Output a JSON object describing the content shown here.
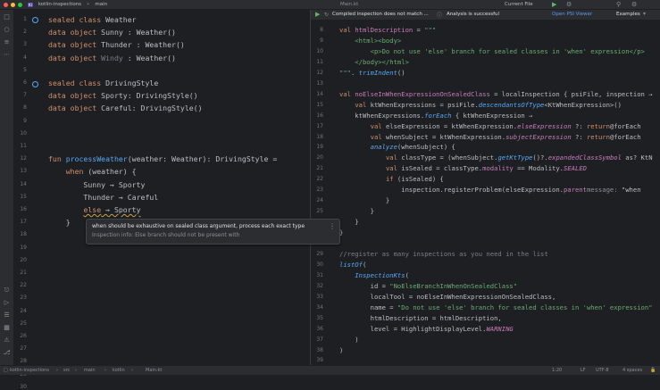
{
  "titlebar": {
    "project_badge": "KI",
    "project": "kotlin-inspections",
    "branch": "main",
    "file_center": "Main.kt",
    "run_config": "Current File"
  },
  "right_header": {
    "notification_1": "Compiled inspection does not match ...",
    "notification_2": "Analysis is successful",
    "psi_viewer": "Open PSI Viewer",
    "examples": "Examples"
  },
  "left_editor": {
    "line_numbers": [
      "1",
      "2",
      "3",
      "4",
      "5",
      "6",
      "7",
      "8",
      "9",
      "10",
      "11",
      "12",
      "13",
      "14",
      "15",
      "16",
      "17",
      "18",
      "19",
      "20",
      "21",
      "22",
      "23",
      "24",
      "25",
      "26",
      "27",
      "28",
      "29",
      "30"
    ],
    "lines": [
      [
        [
          "kw",
          "sealed class "
        ],
        [
          "",
          "Weather"
        ]
      ],
      [
        [
          "kw",
          "data object "
        ],
        [
          "",
          "Sunny : Weather()"
        ]
      ],
      [
        [
          "kw",
          "data object "
        ],
        [
          "",
          "Thunder : Weather()"
        ]
      ],
      [
        [
          "kw",
          "data object "
        ],
        [
          "muted",
          "Windy"
        ],
        [
          "",
          " : Weather()"
        ]
      ],
      [],
      [
        [
          "kw",
          "sealed class "
        ],
        [
          "",
          "DrivingStyle"
        ]
      ],
      [
        [
          "kw",
          "data object "
        ],
        [
          "",
          "Sporty: DrivingStyle()"
        ]
      ],
      [
        [
          "kw",
          "data object "
        ],
        [
          "",
          "Careful: DrivingStyle()"
        ]
      ],
      [],
      [],
      [],
      [
        [
          "kw",
          "fun "
        ],
        [
          "fn",
          "processWeather"
        ],
        [
          "",
          "(weather: Weather): DrivingStyle ="
        ]
      ],
      [
        [
          "",
          "    "
        ],
        [
          "kw",
          "when"
        ],
        [
          "",
          " (weather) {"
        ]
      ],
      [
        [
          "",
          "        Sunny → Sporty"
        ]
      ],
      [
        [
          "",
          "        Thunder → Careful"
        ]
      ],
      [
        [
          "",
          "        "
        ],
        [
          "kw warn-u",
          "else"
        ],
        [
          "warn-u",
          " → Sporty"
        ]
      ],
      [
        [
          "",
          "    }"
        ]
      ]
    ]
  },
  "popup": {
    "message": "when should be exhaustive on sealed class argument, process each exact type",
    "info": "Inspection info: Else branch should not be present with"
  },
  "right_editor": {
    "line_numbers": [
      "8",
      "9",
      "10",
      "11",
      "12",
      "13",
      "14",
      "15",
      "16",
      "17",
      "18",
      "19",
      "20",
      "21",
      "22",
      "23",
      "24",
      "25",
      "26",
      "27",
      "28",
      "29",
      "30",
      "31",
      "32",
      "33",
      "34",
      "35",
      "36",
      "37",
      "38",
      "39"
    ],
    "lines": [
      [
        [
          "kw",
          "val "
        ],
        [
          "prop",
          "htmlDescription"
        ],
        [
          "",
          " = "
        ],
        [
          "str",
          "\"\"\""
        ]
      ],
      [
        [
          "str",
          "    <html><body>"
        ]
      ],
      [
        [
          "str",
          "        <p>Do not use 'else' branch for sealed classes in 'when' expression</p>"
        ]
      ],
      [
        [
          "str",
          "    </body></html>"
        ]
      ],
      [
        [
          "str",
          "\"\"\""
        ],
        [
          "",
          ". "
        ],
        [
          "fn it",
          "trimIndent"
        ],
        [
          "",
          "()"
        ]
      ],
      [],
      [
        [
          "kw",
          "val "
        ],
        [
          "prop",
          "noElseInWhenExpressionOnSealedClass"
        ],
        [
          "",
          " = localInspection { psiFile, inspection →"
        ]
      ],
      [
        [
          "",
          "    "
        ],
        [
          "kw",
          "val "
        ],
        [
          "",
          "ktWhenExpressions = psiFile."
        ],
        [
          "fn it",
          "descendantsOfType"
        ],
        [
          "",
          "<KtWhenExpression>()"
        ]
      ],
      [
        [
          "",
          "    ktWhenExpressions."
        ],
        [
          "fn it",
          "forEach"
        ],
        [
          "",
          " { ktWhenExpression →"
        ]
      ],
      [
        [
          "",
          "        "
        ],
        [
          "kw",
          "val "
        ],
        [
          "",
          "elseExpression = ktWhenExpression."
        ],
        [
          "prop it",
          "elseExpression"
        ],
        [
          "",
          " ?: "
        ],
        [
          "kw",
          "return"
        ],
        [
          "",
          "@forEach"
        ]
      ],
      [
        [
          "",
          "        "
        ],
        [
          "kw",
          "val "
        ],
        [
          "",
          "whenSubject = ktWhenExpression."
        ],
        [
          "prop it",
          "subjectExpression"
        ],
        [
          "",
          " ?: "
        ],
        [
          "kw",
          "return"
        ],
        [
          "",
          "@forEach"
        ]
      ],
      [
        [
          "",
          "        "
        ],
        [
          "fn it",
          "analyze"
        ],
        [
          "",
          "(whenSubject) {"
        ]
      ],
      [
        [
          "",
          "            "
        ],
        [
          "kw",
          "val "
        ],
        [
          "",
          "classType = (whenSubject."
        ],
        [
          "fn it",
          "getKtType"
        ],
        [
          "",
          "()?."
        ],
        [
          "prop it",
          "expandedClassSymbol"
        ],
        [
          "",
          " as? KtN"
        ]
      ],
      [
        [
          "",
          "            "
        ],
        [
          "kw",
          "val "
        ],
        [
          "",
          "isSealed = classType."
        ],
        [
          "prop",
          "modality"
        ],
        [
          "",
          " == Modality."
        ],
        [
          "enumc",
          "SEALED"
        ]
      ],
      [
        [
          "",
          "            "
        ],
        [
          "kw",
          "if "
        ],
        [
          "",
          "(isSealed) {"
        ]
      ],
      [
        [
          "",
          "                inspection.registerProblem(elseExpression."
        ],
        [
          "prop",
          "parent"
        ],
        [
          ",  "
        ],
        [
          "hl",
          "message:"
        ],
        [
          "",
          " \"when"
        ]
      ],
      [
        [
          "",
          "            }"
        ]
      ],
      [
        [
          "",
          "        }"
        ]
      ],
      [
        [
          "",
          "    }"
        ]
      ],
      [
        [
          "",
          "}"
        ]
      ],
      [],
      [
        [
          "cm",
          "//register as many inspections as you need in the list"
        ]
      ],
      [
        [
          "fn it",
          "listOf"
        ],
        [
          "",
          "("
        ]
      ],
      [
        [
          "",
          "    "
        ],
        [
          "fn it",
          "InspectionKts"
        ],
        [
          "",
          "("
        ]
      ],
      [
        [
          "",
          "        id = "
        ],
        [
          "str",
          "\"NoElseBranchInWhenOnSealedClass\""
        ],
        [
          ","
        ]
      ],
      [
        [
          "",
          "        localTool = noElseInWhenExpressionOnSealedClass,"
        ]
      ],
      [
        [
          "",
          "        name = "
        ],
        [
          "str",
          "\"Do not use 'else' branch for sealed classes in 'when' expression\""
        ]
      ],
      [
        [
          "",
          "        htmlDescription = htmlDescription,"
        ]
      ],
      [
        [
          "",
          "        level = HighlightDisplayLevel."
        ],
        [
          "enumc",
          "WARNING"
        ],
        [
          ","
        ]
      ],
      [
        [
          "",
          "    )"
        ]
      ],
      [
        [
          "",
          ")"
        ]
      ]
    ]
  },
  "statusbar": {
    "breadcrumbs": [
      "kotlin-inspections",
      "src",
      "main",
      "kotlin",
      "Main.kt"
    ],
    "position": "1:20",
    "line_sep": "LF",
    "encoding": "UTF-8",
    "indent": "4 spaces"
  },
  "colors": {
    "background": "#1e1f22",
    "panel": "#2b2d30",
    "keyword": "#cf8e6d",
    "function": "#56a8f5",
    "string": "#6aab73",
    "property": "#c77dbb",
    "link": "#589df6"
  }
}
